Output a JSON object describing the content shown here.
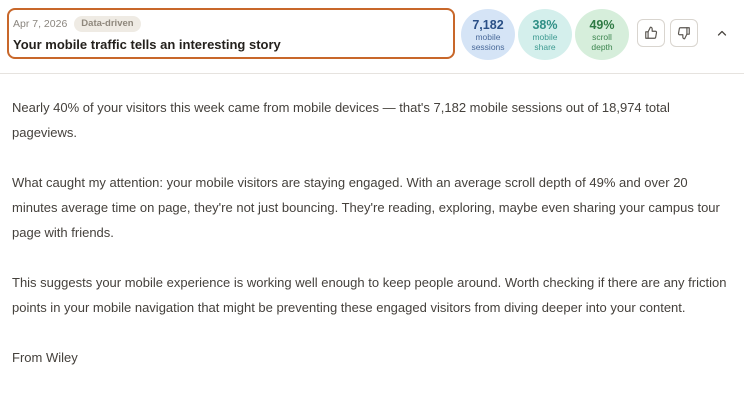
{
  "insight": {
    "date": "Apr 7, 2026",
    "tag": "Data-driven",
    "title": "Your mobile traffic tells an interesting story"
  },
  "stats": [
    {
      "value": "7,182",
      "label_line1": "mobile",
      "label_line2": "sessions",
      "color": "#d5e4f6"
    },
    {
      "value": "38%",
      "label_line1": "mobile",
      "label_line2": "share",
      "color": "#d4efec"
    },
    {
      "value": "49%",
      "label_line1": "scroll",
      "label_line2": "depth",
      "color": "#d6eedb"
    }
  ],
  "actions": {
    "thumbs_up_icon": "thumbs-up-icon",
    "thumbs_down_icon": "thumbs-down-icon",
    "collapse_icon": "chevron-up-icon"
  },
  "body": {
    "paragraphs": [
      "Nearly 40% of your visitors this week came from mobile devices — that's 7,182 mobile sessions out of 18,974 total pageviews.",
      "What caught my attention: your mobile visitors are staying engaged. With an average scroll depth of 49% and over 20 minutes average time on page, they're not just bouncing. They're reading, exploring, maybe even sharing your campus tour page with friends.",
      "This suggests your mobile experience is working well enough to keep people around. Worth checking if there are any friction points in your mobile navigation that might be preventing these engaged visitors from diving deeper into your content."
    ],
    "signoff": "From Wiley"
  },
  "colors": {
    "accent_border": "#c8672a"
  }
}
